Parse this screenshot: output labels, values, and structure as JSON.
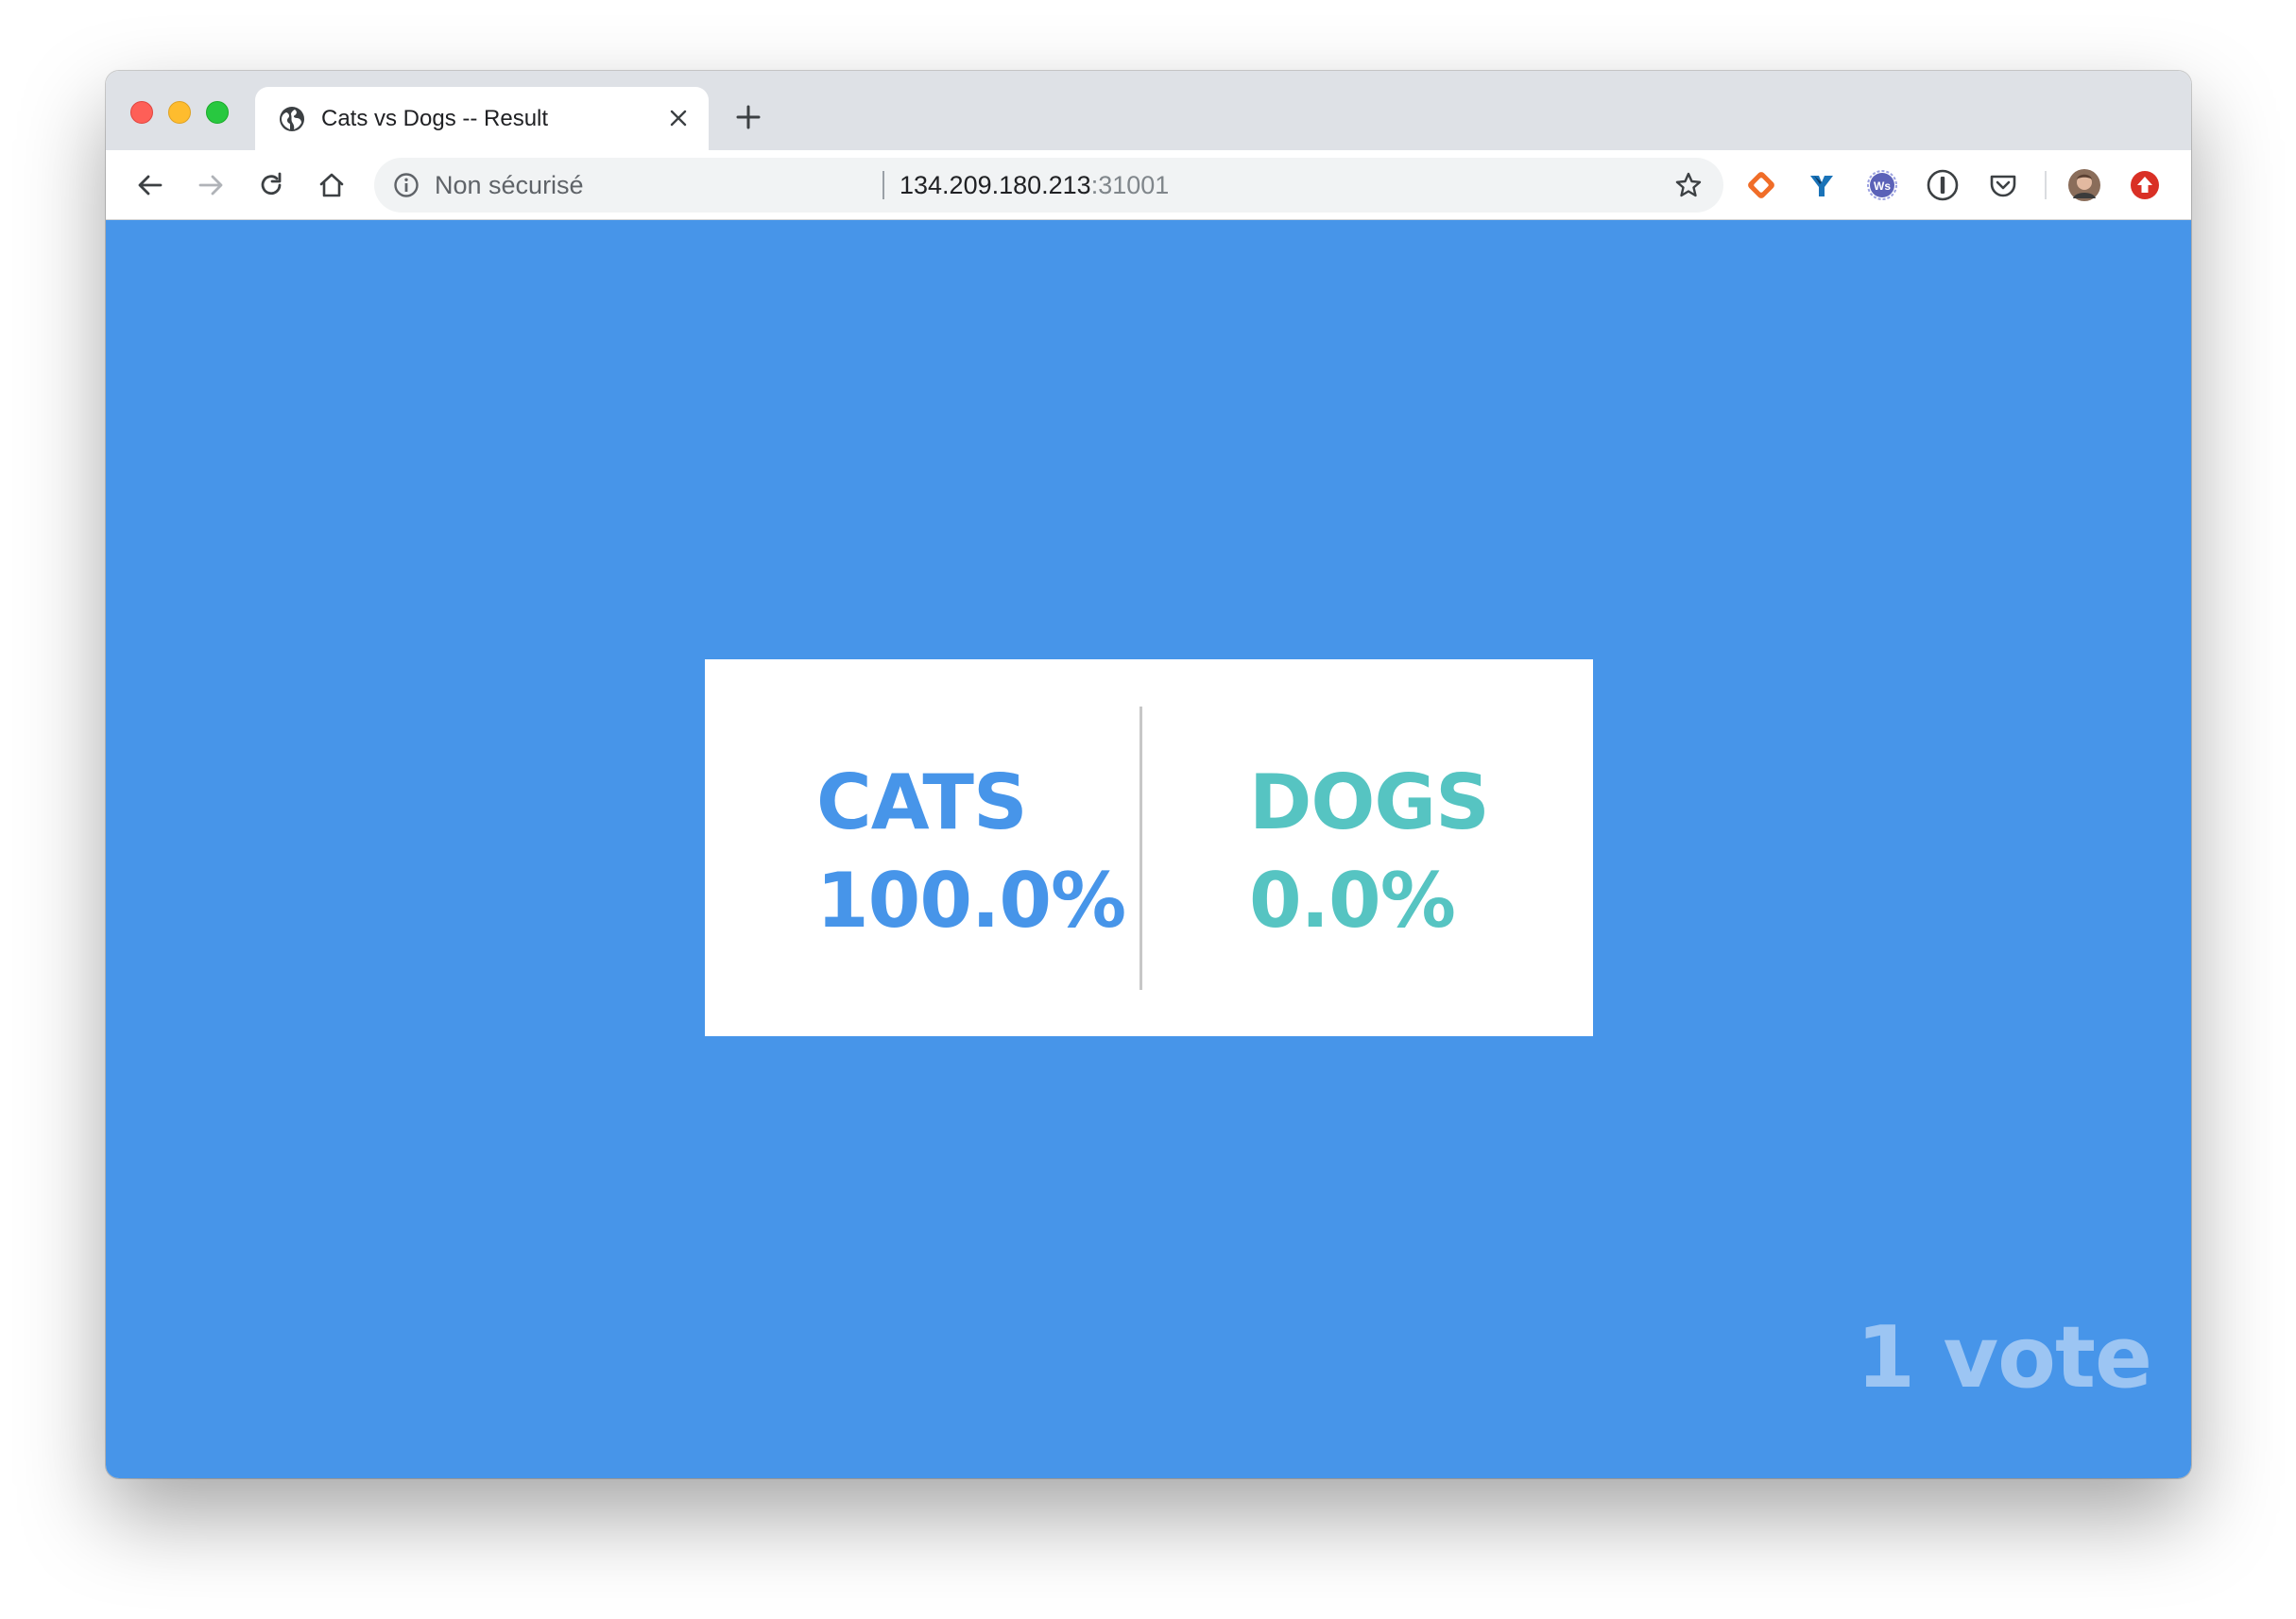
{
  "browser": {
    "tab": {
      "title": "Cats vs Dogs -- Result",
      "favicon": "globe-icon"
    },
    "omnibox": {
      "security_label": "Non sécurisé",
      "host": "134.209.180.213",
      "port": ":31001"
    },
    "extensions": [
      "diamond-extension-icon",
      "y-extension-icon",
      "ws-extension-icon",
      "1password-icon",
      "pocket-icon",
      "profile-avatar",
      "update-icon"
    ]
  },
  "colors": {
    "background": "#4795e9",
    "cats": "#4795e9",
    "dogs": "#56c4c2",
    "votes": "#9cc5f3"
  },
  "results": {
    "cats": {
      "label": "CATS",
      "percent": "100.0%"
    },
    "dogs": {
      "label": "DOGS",
      "percent": "0.0%"
    }
  },
  "votes": {
    "text": "1 vote"
  }
}
